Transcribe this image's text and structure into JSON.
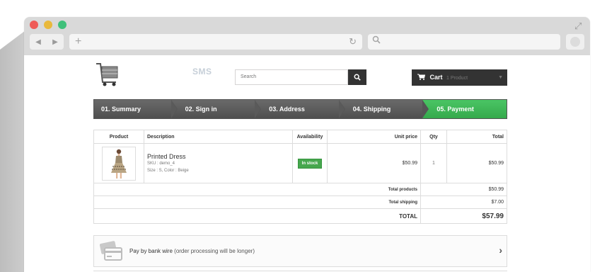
{
  "browser": {
    "nav_back": "◀",
    "nav_forward": "▶",
    "url_plus": "+",
    "reload": "↻"
  },
  "header": {
    "shop_name": "SMS",
    "search_placeholder": "Search",
    "cart_label": "Cart",
    "cart_count": "1 Product"
  },
  "steps": [
    {
      "label": "01. Summary"
    },
    {
      "label": "02. Sign in"
    },
    {
      "label": "03. Address"
    },
    {
      "label": "04. Shipping"
    },
    {
      "label": "05. Payment"
    }
  ],
  "table": {
    "headers": {
      "product": "Product",
      "description": "Description",
      "availability": "Availability",
      "unit_price": "Unit price",
      "qty": "Qty",
      "total": "Total"
    },
    "row": {
      "name": "Printed Dress",
      "sku": "SKU : demo_4",
      "attributes": "Size : S, Color : Beige",
      "availability": "In stock",
      "unit_price": "$50.99",
      "qty": "1",
      "total": "$50.99"
    },
    "totals": {
      "products_label": "Total products",
      "products_value": "$50.99",
      "shipping_label": "Total shipping",
      "shipping_value": "$7.00",
      "total_label": "TOTAL",
      "total_value": "$57.99"
    }
  },
  "payment": {
    "method": "Pay by bank wire",
    "note": "(order processing will be longer)"
  },
  "colors": {
    "step_active": "#3db54f",
    "step_inactive": "#5a5a5a",
    "in_stock": "#46a74e",
    "cart_bg": "#333333"
  }
}
